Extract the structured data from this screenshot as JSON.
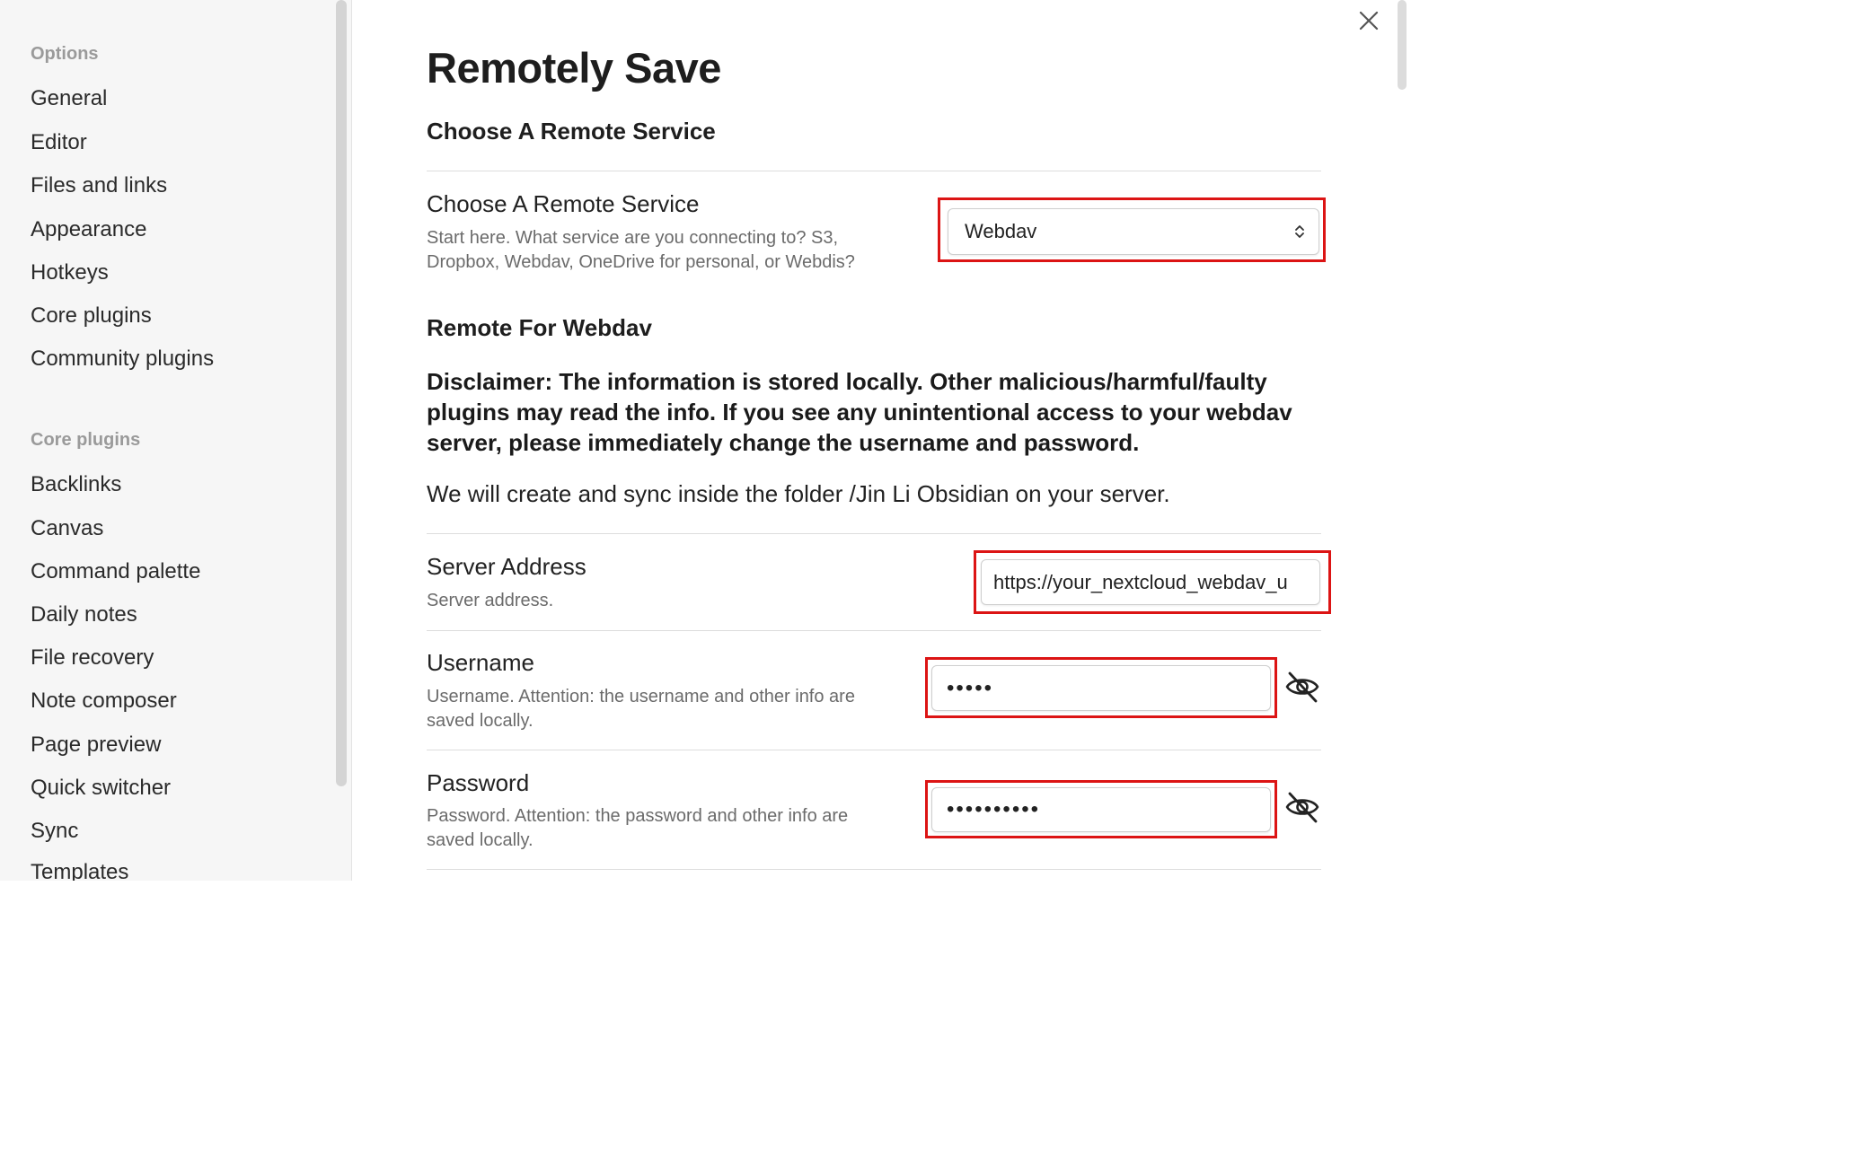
{
  "sidebar": {
    "options_title": "Options",
    "options_items": [
      {
        "label": "General"
      },
      {
        "label": "Editor"
      },
      {
        "label": "Files and links"
      },
      {
        "label": "Appearance"
      },
      {
        "label": "Hotkeys"
      },
      {
        "label": "Core plugins"
      },
      {
        "label": "Community plugins"
      }
    ],
    "core_plugins_title": "Core plugins",
    "core_items": [
      {
        "label": "Backlinks"
      },
      {
        "label": "Canvas"
      },
      {
        "label": "Command palette"
      },
      {
        "label": "Daily notes"
      },
      {
        "label": "File recovery"
      },
      {
        "label": "Note composer"
      },
      {
        "label": "Page preview"
      },
      {
        "label": "Quick switcher"
      },
      {
        "label": "Sync"
      },
      {
        "label": "Templates"
      }
    ]
  },
  "main": {
    "title": "Remotely Save",
    "choose_heading": "Choose A Remote Service",
    "remote_service": {
      "name": "Choose A Remote Service",
      "desc_line1": "Start here. What service are you connecting to? S3,",
      "desc_line2": "Dropbox, Webdav, OneDrive for personal, or Webdis?",
      "selected": "Webdav"
    },
    "webdav_heading": "Remote For Webdav",
    "disclaimer": "Disclaimer: The information is stored locally. Other malicious/harmful/faulty plugins may read the info. If you see any unintentional access to your webdav server, please immediately change the username and password.",
    "folder_note": "We will create and sync inside the folder /Jin Li Obsidian on your server.",
    "server_address": {
      "name": "Server Address",
      "desc": "Server address.",
      "value": "https://your_nextcloud_webdav_u"
    },
    "username": {
      "name": "Username",
      "desc_line1": "Username. Attention: the username and other info are",
      "desc_line2": "saved locally.",
      "value": "•••••"
    },
    "password": {
      "name": "Password",
      "desc_line1": "Password. Attention: the password and other info are",
      "desc_line2": "saved locally.",
      "value": "••••••••••"
    }
  },
  "colors": {
    "highlight": "#dc1414",
    "sidebar_bg": "#f6f6f6"
  },
  "icons": {
    "close": "close-icon",
    "chevron": "chevron-up-down-icon",
    "eye": "eye-off-icon"
  }
}
